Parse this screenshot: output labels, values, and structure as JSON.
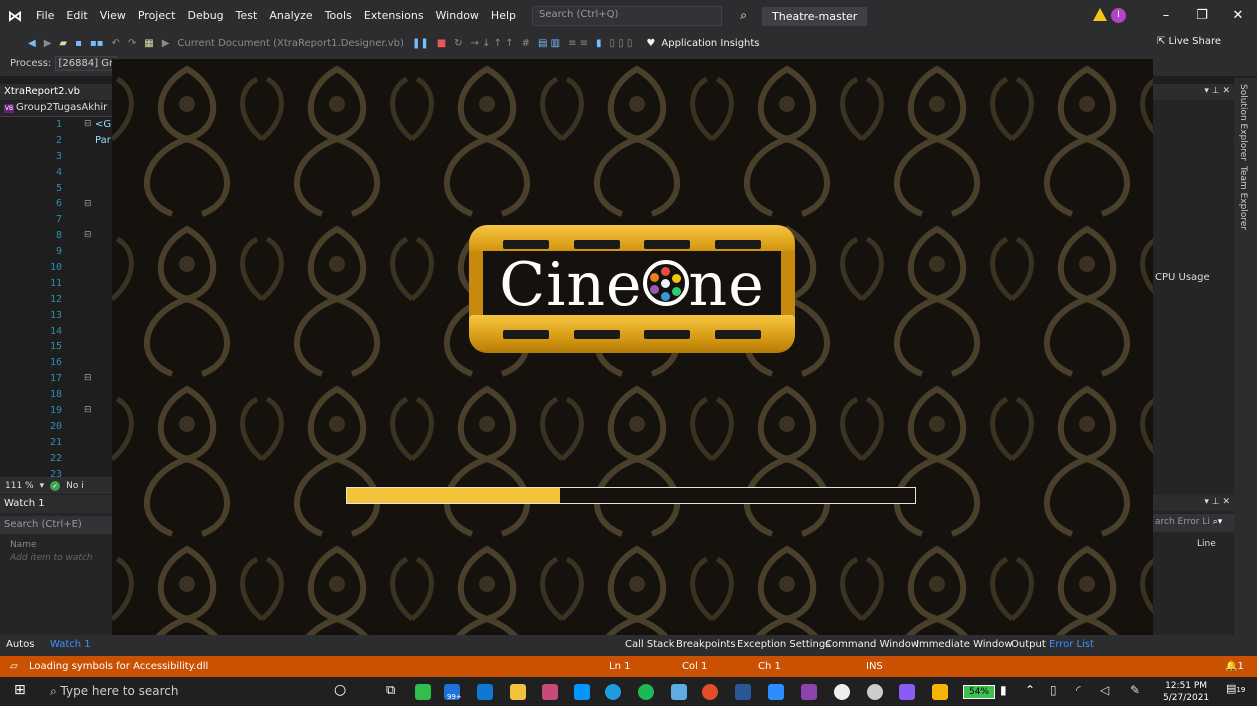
{
  "menubar": {
    "items": [
      "File",
      "Edit",
      "View",
      "Project",
      "Debug",
      "Test",
      "Analyze",
      "Tools",
      "Extensions",
      "Window",
      "Help"
    ],
    "search_placeholder": "Search (Ctrl+Q)",
    "solution_name": "Theatre-master",
    "user_initial": "I"
  },
  "toolbar": {
    "current_document": "Current Document (XtraReport1.Designer.vb)",
    "app_insights": "Application Insights",
    "live_share": "Live Share"
  },
  "process": {
    "label": "Process:",
    "value": "[26884] Gr"
  },
  "editor": {
    "tab": "XtraReport2.vb",
    "nav": "Group2TugasAkhir",
    "lines": [
      "1",
      "2",
      "3",
      "4",
      "5",
      "6",
      "7",
      "8",
      "9",
      "10",
      "11",
      "12",
      "13",
      "14",
      "15",
      "16",
      "17",
      "18",
      "19",
      "20",
      "21",
      "22",
      "23"
    ],
    "code_line1": "<G",
    "code_line2": "Par",
    "zoom": "111 %",
    "no_issues": "No i"
  },
  "watch": {
    "title": "Watch 1",
    "search_placeholder": "Search (Ctrl+E)",
    "col_name": "Name",
    "add_item": "Add item to watch"
  },
  "right_panel": {
    "cpu_usage": "CPU Usage",
    "error_search": "arch Error Li",
    "col_line": "Line",
    "side_tabs": [
      "Solution Explorer",
      "Team Explorer"
    ]
  },
  "bottom_tabs": {
    "left": [
      "Autos",
      "Watch 1"
    ],
    "right": [
      "Call Stack",
      "Breakpoints",
      "Exception Settings",
      "Command Window",
      "Immediate Window",
      "Output",
      "Error List"
    ]
  },
  "statusbar": {
    "message": "Loading symbols for Accessibility.dll",
    "ln": "Ln 1",
    "col": "Col 1",
    "ch": "Ch 1",
    "mode": "INS",
    "notifications": "1"
  },
  "splash": {
    "logo_text_left": "Cine",
    "logo_text_right": "ne",
    "progress": 0.375
  },
  "taskbar": {
    "search_placeholder": "Type here to search",
    "mail_badge": "99+",
    "battery": "54%",
    "time": "12:51 PM",
    "date": "5/27/2021",
    "notif_count": "19"
  },
  "colors": {
    "accent_orange": "#ca5100",
    "logo_gold": "#f3c33c",
    "progress_fill": "#f3c33c"
  }
}
